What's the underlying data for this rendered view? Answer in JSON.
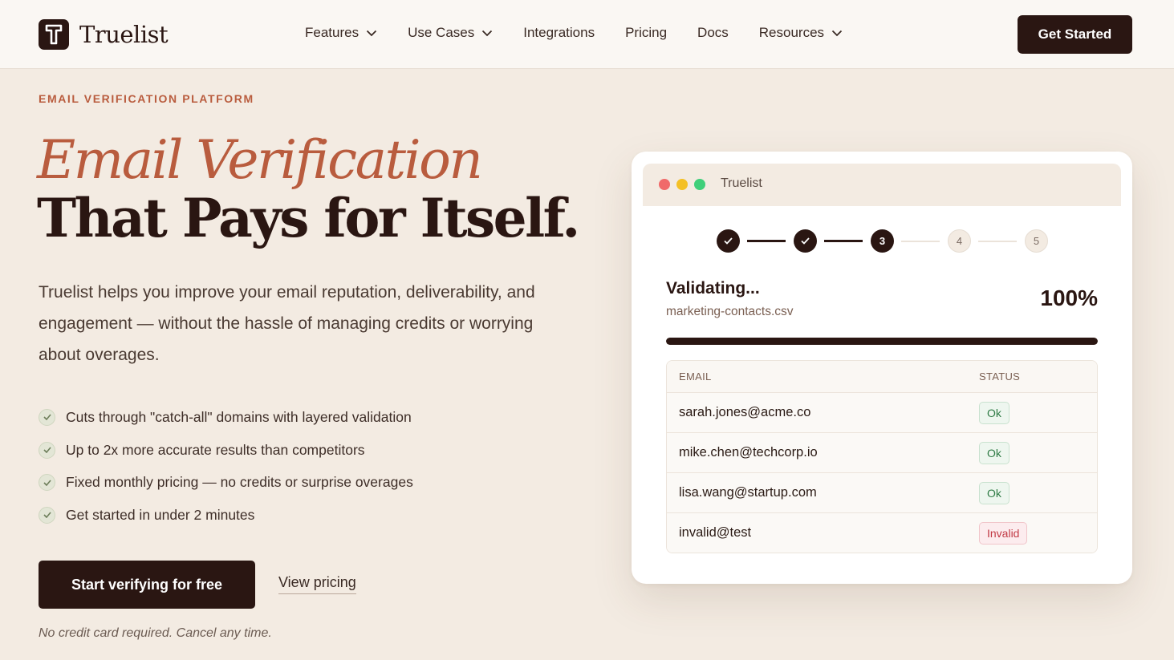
{
  "brand": {
    "name": "Truelist",
    "accent": "#b95c3e",
    "dark": "#2a1612"
  },
  "nav": {
    "items": [
      {
        "label": "Features",
        "has_dropdown": true
      },
      {
        "label": "Use Cases",
        "has_dropdown": true
      },
      {
        "label": "Integrations",
        "has_dropdown": false
      },
      {
        "label": "Pricing",
        "has_dropdown": false
      },
      {
        "label": "Docs",
        "has_dropdown": false
      },
      {
        "label": "Resources",
        "has_dropdown": true
      }
    ],
    "cta": "Get Started"
  },
  "hero": {
    "eyebrow": "EMAIL VERIFICATION PLATFORM",
    "title_line1": "Email Verification",
    "title_line2": "That Pays for Itself.",
    "lead": "Truelist helps you improve your email reputation, deliverability, and engagement — without the hassle of managing credits or worrying about overages.",
    "features": [
      "Cuts through \"catch-all\" domains with layered validation",
      "Up to 2x more accurate results than competitors",
      "Fixed monthly pricing — no credits or surprise overages",
      "Get started in under 2 minutes"
    ],
    "primary_cta": "Start verifying for free",
    "secondary_cta": "View pricing",
    "note": "No credit card required. Cancel any time."
  },
  "demo": {
    "window_title": "Truelist",
    "window_dots": [
      "#f06a6a",
      "#f4c025",
      "#3fcf7a"
    ],
    "steps": [
      {
        "label": "",
        "state": "done"
      },
      {
        "label": "",
        "state": "done"
      },
      {
        "label": "3",
        "state": "current"
      },
      {
        "label": "4",
        "state": "todo"
      },
      {
        "label": "5",
        "state": "todo"
      }
    ],
    "status_title": "Validating...",
    "file_name": "marketing-contacts.csv",
    "percent_label": "100%",
    "progress": 1.0,
    "table": {
      "headers": [
        "EMAIL",
        "STATUS"
      ],
      "rows": [
        {
          "email": "sarah.jones@acme.co",
          "status": "Ok",
          "kind": "ok"
        },
        {
          "email": "mike.chen@techcorp.io",
          "status": "Ok",
          "kind": "ok"
        },
        {
          "email": "lisa.wang@startup.com",
          "status": "Ok",
          "kind": "ok"
        },
        {
          "email": "invalid@test",
          "status": "Invalid",
          "kind": "invalid"
        }
      ]
    }
  }
}
